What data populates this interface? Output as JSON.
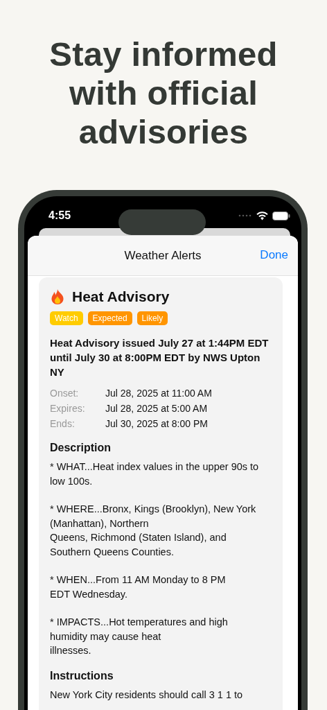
{
  "headline": "Stay informed with official advisories",
  "status_bar": {
    "time": "4:55"
  },
  "sheet": {
    "title": "Weather Alerts",
    "done": "Done"
  },
  "alert": {
    "title": "Heat Advisory",
    "tags": [
      {
        "label": "Watch",
        "color": "#ffcc00"
      },
      {
        "label": "Expected",
        "color": "#ff9500"
      },
      {
        "label": "Likely",
        "color": "#ff9500"
      }
    ],
    "headline": "Heat Advisory issued July 27 at 1:44PM EDT until July 30 at 8:00PM EDT by NWS Upton NY",
    "times": [
      {
        "label": "Onset:",
        "value": "Jul 28, 2025 at 11:00 AM"
      },
      {
        "label": "Expires:",
        "value": "Jul 28, 2025 at 5:00 AM"
      },
      {
        "label": "Ends:",
        "value": "Jul 30, 2025 at 8:00 PM"
      }
    ],
    "description_heading": "Description",
    "description": [
      "* WHAT...Heat index values in the upper 90s to\nlow 100s.",
      "* WHERE...Bronx, Kings (Brooklyn), New York\n(Manhattan), Northern\nQueens, Richmond (Staten Island), and\nSouthern Queens Counties.",
      "* WHEN...From 11 AM Monday to 8 PM\nEDT Wednesday.",
      "* IMPACTS...Hot temperatures and high\nhumidity may cause heat\nillnesses."
    ],
    "instructions_heading": "Instructions",
    "instructions": "New York City residents should call 3 1 1 to"
  }
}
